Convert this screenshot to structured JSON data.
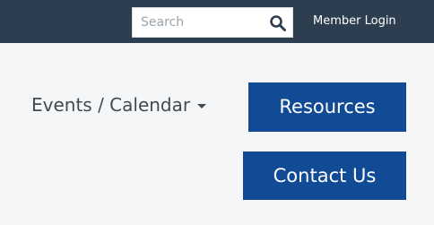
{
  "header": {
    "search": {
      "placeholder": "Search",
      "value": "",
      "icon": "search-icon"
    },
    "member_login_label": "Member Login"
  },
  "nav": {
    "events_calendar_label": "Events / Calendar",
    "resources_label": "Resources",
    "contact_label": "Contact Us"
  },
  "colors": {
    "topbar": "#2c3e50",
    "button": "#114a95",
    "background": "#f5f6f7"
  }
}
